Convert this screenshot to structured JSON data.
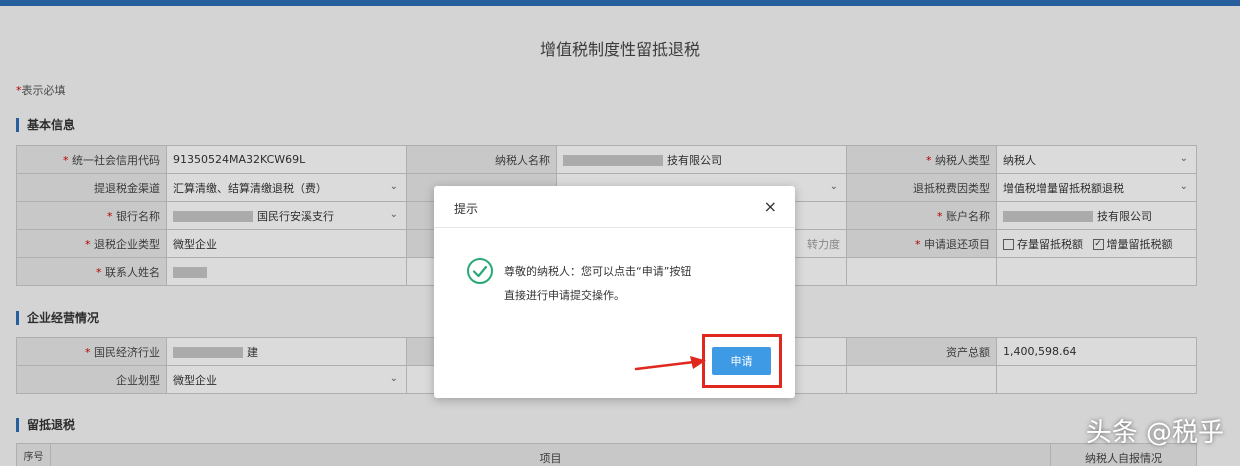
{
  "page_title": "增值税制度性留抵退税",
  "required_note": {
    "star": "*",
    "text": "表示必填"
  },
  "sections": {
    "basic": "基本信息",
    "operation": "企业经营情况",
    "refund": "留抵退税"
  },
  "basic": {
    "credit_code_label": "统一社会信用代码",
    "credit_code_value": "91350524MA32KCW69L",
    "taxpayer_name_label": "纳税人名称",
    "taxpayer_name_value": "技有限公司",
    "taxpayer_type_label": "纳税人类型",
    "taxpayer_type_value": "纳税人",
    "refund_channel_label": "提退税金渠道",
    "refund_channel_value": "汇算清缴、结算清缴退税（费）",
    "refund_type_label": "退抵税费因类型",
    "refund_type_value": "增值税增量留抵税额退税",
    "bank_label": "银行名称",
    "bank_value": "国民行安溪支行",
    "account_name_label": "账户名称",
    "account_name_value": "技有限公司",
    "enterprise_label": "退税企业类型",
    "enterprise_value": "微型企业",
    "faint_text": "转力度",
    "apply_item_label": "申请退还项目",
    "stock_label": "存量留抵税额",
    "increment_label": "增量留抵税额",
    "contact_label": "联系人姓名"
  },
  "operation": {
    "industry_label": "国民经济行业",
    "industry_value": "建",
    "assets_label": "资产总额",
    "assets_value": "1,400,598.64",
    "scale_label": "企业划型",
    "scale_value": "微型企业"
  },
  "refund_table": {
    "seq_header": "序号",
    "item_header": "项目",
    "self_header": "纳税人自报情况"
  },
  "modal": {
    "title": "提示",
    "message_line1": "尊敬的纳税人：您可以点击“申请”按钮",
    "message_line2": "直接进行申请提交操作。",
    "apply_label": "申请",
    "close_glyph": "×"
  },
  "watermark": "头条 @税乎",
  "colors": {
    "accent": "#2d6db3",
    "button": "#3f9ae6",
    "highlight": "#e0281e",
    "success": "#2aa876"
  }
}
